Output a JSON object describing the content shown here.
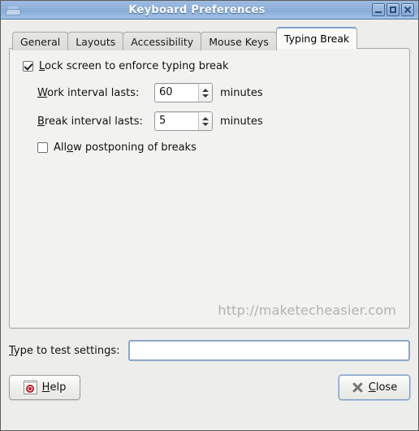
{
  "window": {
    "title": "Keyboard Preferences",
    "icon": "keyboard-icon",
    "controls": {
      "minimize": "minimize-button",
      "maximize": "maximize-button",
      "close": "close-window-button"
    }
  },
  "tabs": [
    {
      "label": "General",
      "active": false
    },
    {
      "label": "Layouts",
      "active": false
    },
    {
      "label": "Accessibility",
      "active": false
    },
    {
      "label": "Mouse Keys",
      "active": false
    },
    {
      "label": "Typing Break",
      "active": true
    }
  ],
  "typing_break": {
    "lock_screen": {
      "label_pre": "",
      "mnemonic": "L",
      "label_post": "ock screen to enforce typing break",
      "checked": true
    },
    "work_interval": {
      "mnemonic": "W",
      "label_pre": "",
      "label_post": "ork interval lasts:",
      "value": "60",
      "unit": "minutes"
    },
    "break_interval": {
      "mnemonic": "B",
      "label_pre": "",
      "label_post": "reak interval lasts:",
      "value": "5",
      "unit": "minutes"
    },
    "allow_postpone": {
      "label_pre": "All",
      "mnemonic": "o",
      "label_post": "w postponing of breaks",
      "checked": false
    },
    "watermark": "http://maketecheasier.com"
  },
  "test_settings": {
    "mnemonic": "T",
    "label_pre": "",
    "label_post": "ype to test settings:",
    "value": "",
    "placeholder": ""
  },
  "buttons": {
    "help": {
      "label_pre": "",
      "mnemonic": "H",
      "label_post": "elp",
      "icon": "help-icon"
    },
    "close": {
      "label_pre": "",
      "mnemonic": "C",
      "label_post": "lose",
      "icon": "close-x-icon"
    }
  },
  "colors": {
    "titlebar": "#87abd7",
    "accent": "#7ca2cd",
    "panel": "#f2f2f0",
    "dialog_bg": "#ededeb",
    "watermark": "#b2b2b2",
    "help_icon_red": "#b5202a"
  }
}
